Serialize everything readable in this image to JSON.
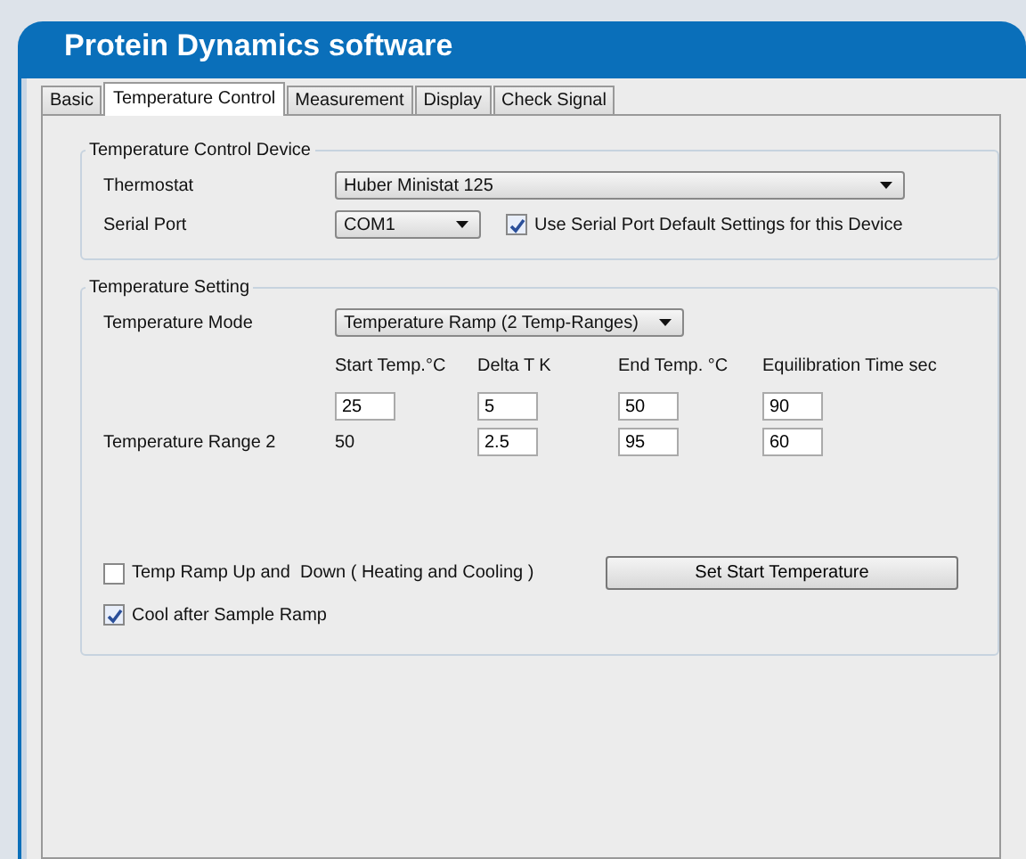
{
  "window": {
    "title": "Protein Dynamics software"
  },
  "tabs": [
    {
      "label": "Basic",
      "selected": false
    },
    {
      "label": "Temperature Control",
      "selected": true
    },
    {
      "label": "Measurement",
      "selected": false
    },
    {
      "label": "Display",
      "selected": false
    },
    {
      "label": "Check Signal",
      "selected": false
    }
  ],
  "device_group": {
    "title": "Temperature Control Device",
    "thermostat_label": "Thermostat",
    "thermostat_value": "Huber Ministat 125",
    "port_label": "Serial Port",
    "port_value": "COM1",
    "default_settings": {
      "label": "Use Serial Port Default Settings for this Device",
      "checked": true
    }
  },
  "setting_group": {
    "title": "Temperature Setting",
    "mode_label": "Temperature Mode",
    "mode_value": "Temperature Ramp (2 Temp-Ranges)",
    "columns": [
      "Start Temp.°C",
      "Delta T K",
      "End Temp. °C",
      "Equilibration Time sec"
    ],
    "rows": [
      {
        "start": "25",
        "start_editable": true,
        "delta": "5",
        "end": "50",
        "time": "90"
      },
      {
        "label": "Temperature Range 2",
        "start": "50",
        "start_editable": false,
        "delta": "2.5",
        "end": "95",
        "time": "60"
      }
    ],
    "up_down": {
      "label": "Temp Ramp Up and  Down ( Heating and Cooling )",
      "checked": false
    },
    "set_button": "Set Start Temperature",
    "cool_after": {
      "label": "Cool after Sample Ramp",
      "checked": true
    }
  }
}
